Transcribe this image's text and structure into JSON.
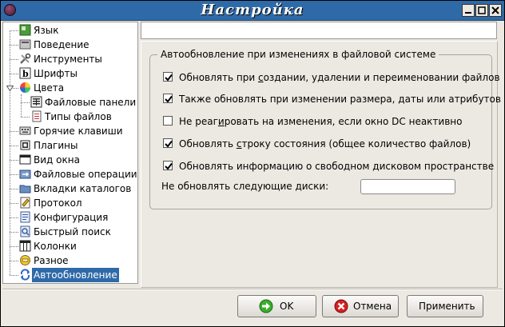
{
  "window": {
    "title": "Настройка"
  },
  "tree": {
    "items": [
      {
        "label": "Язык",
        "icon": "language-icon"
      },
      {
        "label": "Поведение",
        "icon": "behavior-icon"
      },
      {
        "label": "Инструменты",
        "icon": "tools-icon"
      },
      {
        "label": "Шрифты",
        "icon": "fonts-icon"
      },
      {
        "label": "Цвета",
        "icon": "colors-icon",
        "expanded": true
      },
      {
        "label": "Файловые панели",
        "icon": "file-panels-icon",
        "child": true
      },
      {
        "label": "Типы файлов",
        "icon": "file-types-icon",
        "child": true
      },
      {
        "label": "Горячие клавиши",
        "icon": "hotkeys-icon"
      },
      {
        "label": "Плагины",
        "icon": "plugins-icon"
      },
      {
        "label": "Вид окна",
        "icon": "window-view-icon"
      },
      {
        "label": "Файловые операции",
        "icon": "file-operations-icon"
      },
      {
        "label": "Вкладки каталогов",
        "icon": "folder-tabs-icon"
      },
      {
        "label": "Протокол",
        "icon": "log-icon"
      },
      {
        "label": "Конфигурация",
        "icon": "configuration-icon"
      },
      {
        "label": "Быстрый поиск",
        "icon": "quick-search-icon"
      },
      {
        "label": "Колонки",
        "icon": "columns-icon"
      },
      {
        "label": "Разное",
        "icon": "misc-icon"
      },
      {
        "label": "Автообновление",
        "icon": "autorefresh-icon",
        "selected": true
      }
    ]
  },
  "autorefresh": {
    "group_title": "Автообновление при изменениях в файловой системе",
    "options": [
      {
        "label_pre": "Обновлять при ",
        "label_u": "с",
        "label_post": "оздании, удалении и переименовании файлов",
        "checked": true
      },
      {
        "label_pre": "Также обновлять при изменении размера, даты или атрибутов",
        "label_u": "",
        "label_post": "",
        "checked": true
      },
      {
        "label_pre": "Не реаг",
        "label_u": "и",
        "label_post": "ровать на изменения, если окно DC неактивно",
        "checked": false
      },
      {
        "label_pre": "Обновлять ",
        "label_u": "с",
        "label_post": "троку состояния (общее количество файлов)",
        "checked": true
      },
      {
        "label_pre": "Обновлять информацию о свободном дисковом пространстве",
        "label_u": "",
        "label_post": "",
        "checked": true
      }
    ],
    "nodisk_pre": "Не обновлять сле",
    "nodisk_u": "д",
    "nodisk_post": "ующие диски:",
    "nodisk_value": ""
  },
  "buttons": {
    "ok": "OK",
    "cancel": "Отмена",
    "apply": "Применить"
  },
  "colors": {
    "title_bar": "#2f6aa8",
    "selection": "#2f6aa8"
  }
}
